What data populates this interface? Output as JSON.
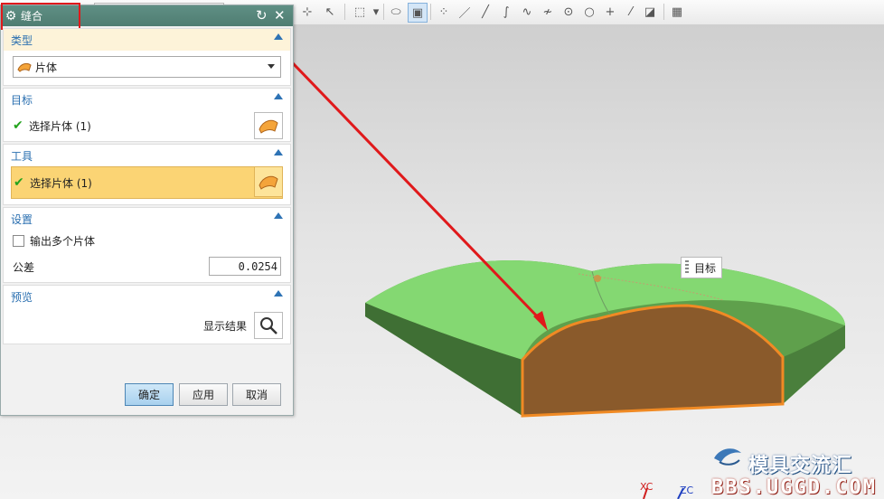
{
  "dialog": {
    "title": "缝合",
    "type_section": {
      "label": "类型",
      "dropdown_value": "片体"
    },
    "target_section": {
      "label": "目标",
      "select_label": "选择片体 (1)"
    },
    "tool_section": {
      "label": "工具",
      "select_label": "选择片体 (1)"
    },
    "settings_section": {
      "label": "设置",
      "multi_output_label": "输出多个片体",
      "multi_output_checked": false,
      "tolerance_label": "公差",
      "tolerance_value": "0.0254"
    },
    "preview_section": {
      "label": "预览",
      "show_result_label": "显示结果"
    },
    "buttons": {
      "ok": "确定",
      "apply": "应用",
      "cancel": "取消"
    }
  },
  "viewport": {
    "target_tag": "目标",
    "axis_xc": "XC",
    "axis_zc": "ZC",
    "watermark_line1": "模具交流汇",
    "watermark_line2": "BBS.UGGD.COM"
  },
  "colors": {
    "accent": "#2a6fb0",
    "highlight": "#fbd474",
    "annotation": "#e0191b",
    "surface_green": "#7ed36f",
    "cut_face": "#8a5a2b"
  }
}
